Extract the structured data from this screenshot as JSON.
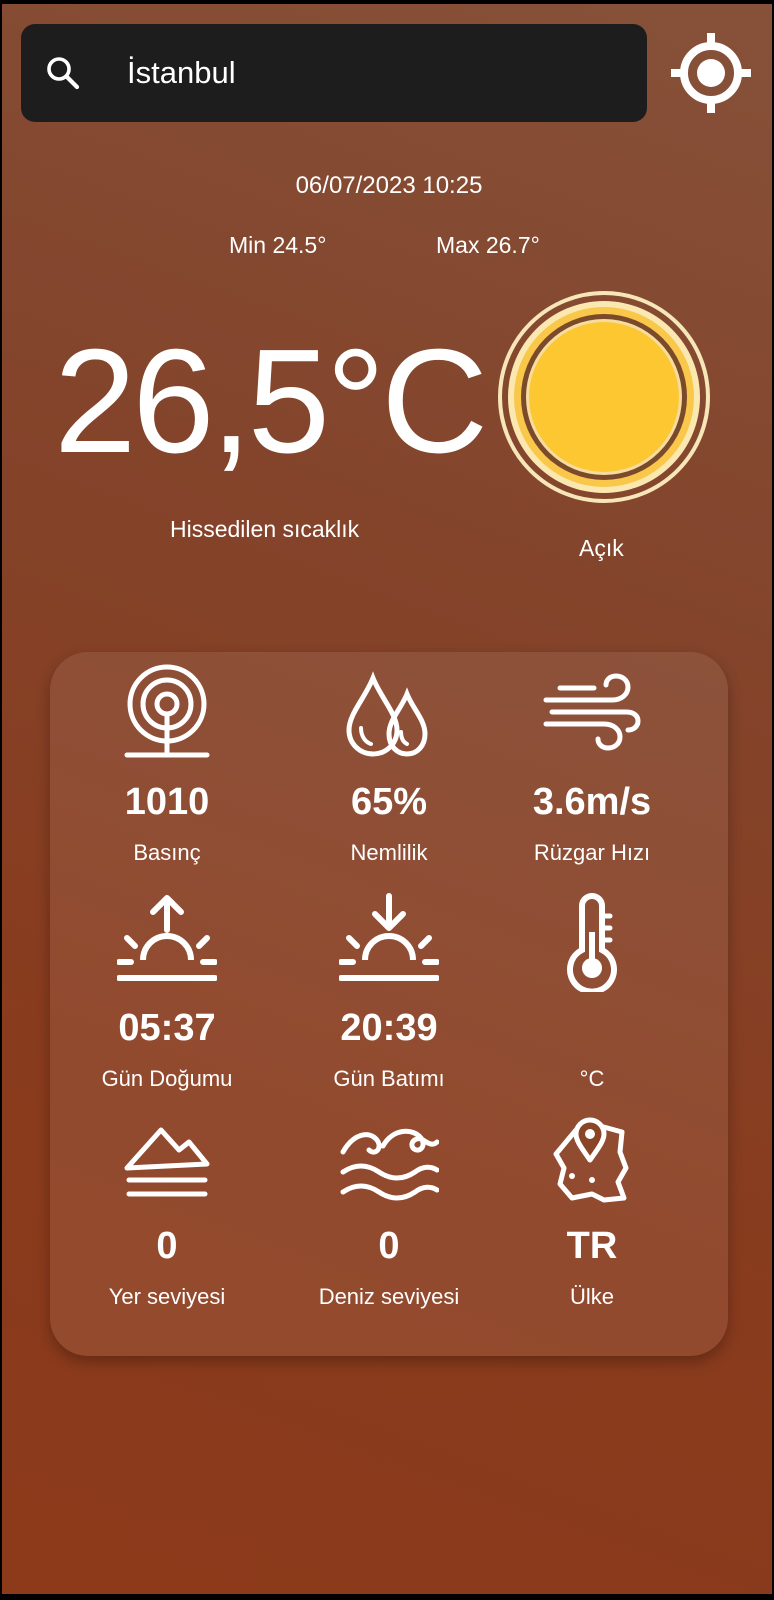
{
  "search": {
    "query": "İstanbul",
    "icon": "search-icon"
  },
  "location_button": {
    "icon": "gps-crosshair-icon"
  },
  "weather": {
    "datetime": "06/07/2023 10:25",
    "min_label": "Min 24.5°",
    "max_label": "Max 26.7°",
    "temperature": "26,5°C",
    "feels_like_label": "Hissedilen sıcaklık",
    "condition_icon": "sun-icon",
    "condition": "Açık"
  },
  "details": [
    {
      "icon": "barometer-icon",
      "value": "1010",
      "label": "Basınç"
    },
    {
      "icon": "humidity-drops-icon",
      "value": "65%",
      "label": "Nemlilik"
    },
    {
      "icon": "wind-icon",
      "value": "3.6m/s",
      "label": "Rüzgar Hızı"
    },
    {
      "icon": "sunrise-icon",
      "value": "05:37",
      "label": "Gün Doğumu"
    },
    {
      "icon": "sunset-icon",
      "value": "20:39",
      "label": "Gün Batımı"
    },
    {
      "icon": "thermometer-icon",
      "value": "",
      "label": "°C"
    },
    {
      "icon": "ground-level-icon",
      "value": "0",
      "label": "Yer seviyesi"
    },
    {
      "icon": "sea-level-icon",
      "value": "0",
      "label": "Deniz seviyesi"
    },
    {
      "icon": "country-map-icon",
      "value": "TR",
      "label": "Ülke"
    }
  ],
  "colors": {
    "background_top": "#875139",
    "background_bottom": "#8c3a1a",
    "search_bar": "#1d1d1d",
    "sun_fill": "#fdc731",
    "sun_ring": "#7a4a2a",
    "sun_outer": "#f6e6b8",
    "text": "#ffffff"
  }
}
